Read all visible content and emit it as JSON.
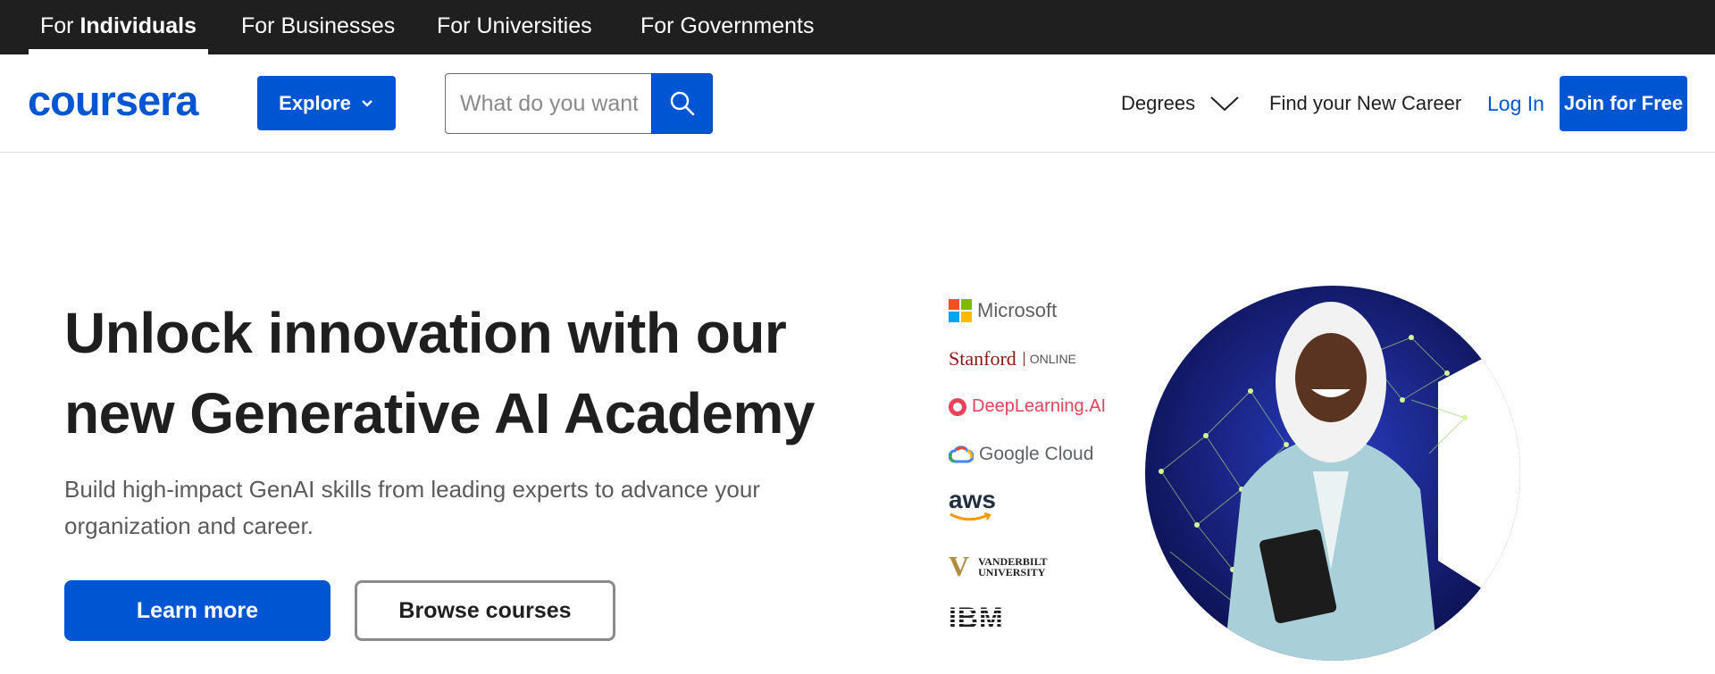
{
  "audience_nav": {
    "individuals_prefix": "For ",
    "individuals_bold": "Individuals",
    "businesses": "For Businesses",
    "universities": "For Universities",
    "governments": "For Governments"
  },
  "header": {
    "logo": "coursera",
    "explore_label": "Explore",
    "search_placeholder": "What do you want to learn?",
    "degrees_label": "Degrees",
    "career_label": "Find your New Career",
    "login_label": "Log In",
    "join_label": "Join for Free"
  },
  "hero": {
    "title_line1": "Unlock innovation with our",
    "title_line2": "new Generative AI Academy",
    "subtitle_line1": "Build high-impact GenAI skills from leading experts to advance your",
    "subtitle_line2": "organization and career.",
    "learn_more": "Learn more",
    "browse_courses": "Browse courses"
  },
  "partners": {
    "microsoft": "Microsoft",
    "stanford": "Stanford",
    "stanford_online": "ONLINE",
    "deeplearning": "DeepLearning.AI",
    "google_cloud": "Google Cloud",
    "aws": "aws",
    "vanderbilt_line1": "VANDERBILT",
    "vanderbilt_line2": "UNIVERSITY",
    "ibm": "IBM"
  },
  "colors": {
    "brand_blue": "#0056d2",
    "top_bar": "#1f1f1f"
  }
}
